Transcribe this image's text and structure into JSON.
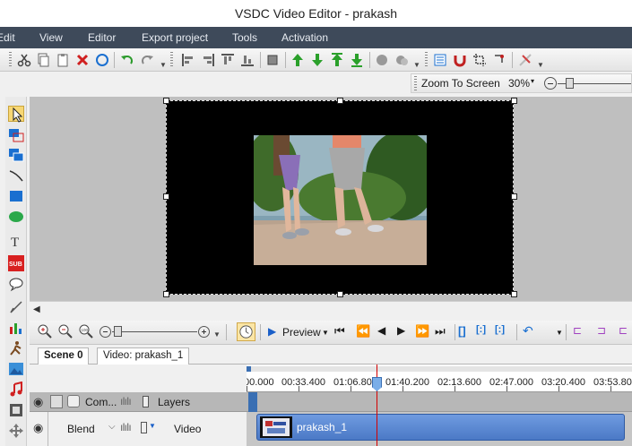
{
  "window": {
    "title": "VSDC Video Editor - prakash"
  },
  "menu": [
    "Edit",
    "View",
    "Editor",
    "Export project",
    "Tools",
    "Activation"
  ],
  "zoom": {
    "mode_label": "Zoom To Screen",
    "percent": "30%"
  },
  "timeline": {
    "preview_label": "Preview",
    "tabs": [
      "Scene 0",
      "Video: prakash_1"
    ],
    "ruler_labels": [
      "00.000",
      "00:33.400",
      "01:06.800",
      "01:40.200",
      "02:13.600",
      "02:47.000",
      "03:20.400",
      "03:53.80"
    ],
    "layers_header": {
      "com": "Com...",
      "layers": "Layers"
    },
    "video_row": {
      "blend": "Blend",
      "type": "Video",
      "clip_name": "prakash_1"
    }
  },
  "colors": {
    "menubar": "#3e4a5a",
    "clip": "#5a86d2",
    "playhead": "#d40000"
  }
}
